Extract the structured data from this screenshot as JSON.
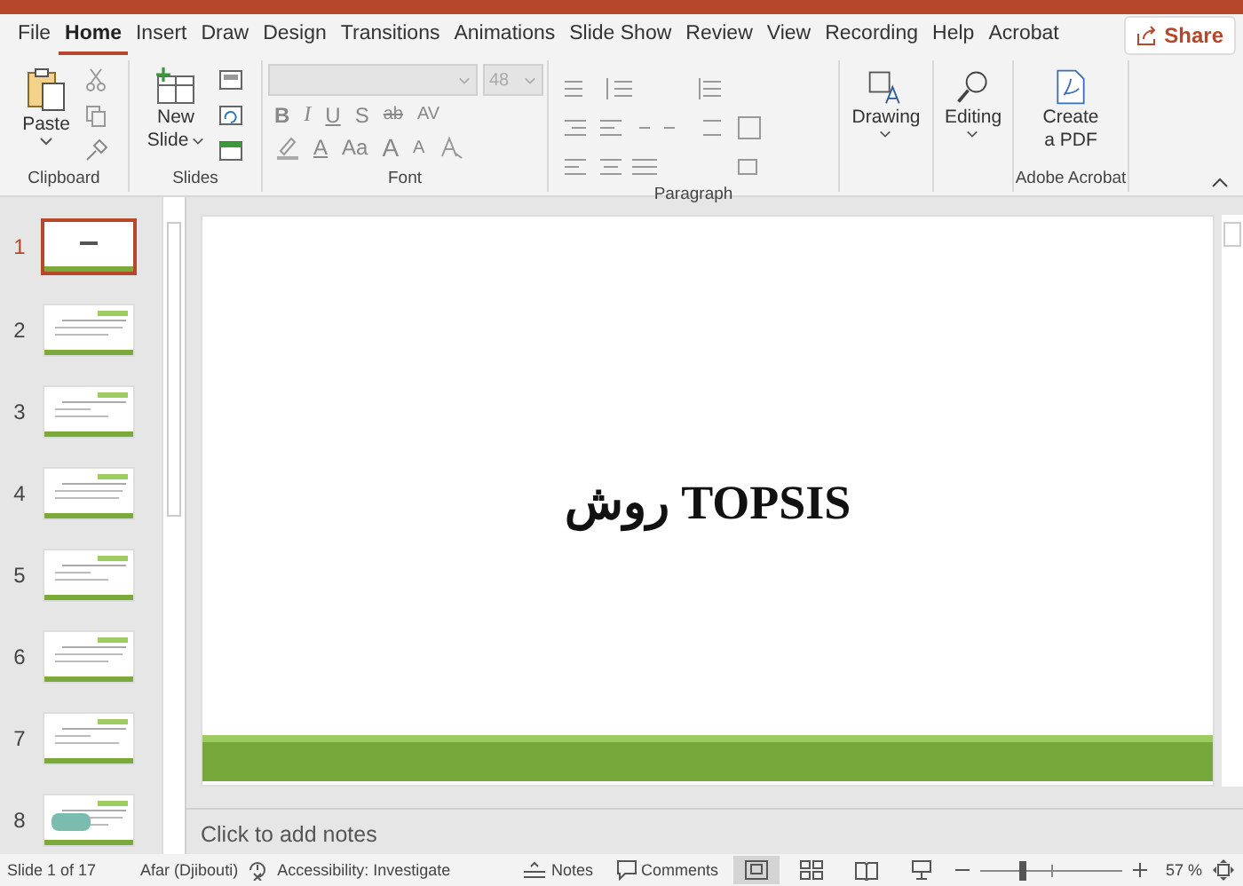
{
  "tabs": [
    {
      "label": "File",
      "selected": false
    },
    {
      "label": "Home",
      "selected": true
    },
    {
      "label": "Insert",
      "selected": false
    },
    {
      "label": "Draw",
      "selected": false
    },
    {
      "label": "Design",
      "selected": false
    },
    {
      "label": "Transitions",
      "selected": false
    },
    {
      "label": "Animations",
      "selected": false
    },
    {
      "label": "Slide Show",
      "selected": false
    },
    {
      "label": "Review",
      "selected": false
    },
    {
      "label": "View",
      "selected": false
    },
    {
      "label": "Recording",
      "selected": false
    },
    {
      "label": "Help",
      "selected": false
    },
    {
      "label": "Acrobat",
      "selected": false
    }
  ],
  "share": {
    "label": "Share"
  },
  "ribbon": {
    "clipboard": {
      "label": "Clipboard",
      "paste": "Paste"
    },
    "slides": {
      "label": "Slides",
      "new_slide": [
        "New",
        "Slide"
      ]
    },
    "font": {
      "label": "Font",
      "size": "48",
      "format_buttons": [
        "B",
        "I",
        "U",
        "S",
        "ab",
        "AV"
      ],
      "font_color": "A",
      "case": "Aa",
      "grow": "A",
      "shrink": "A"
    },
    "paragraph": {
      "label": "Paragraph"
    },
    "drawing": {
      "label": "Drawing"
    },
    "editing": {
      "label": "Editing"
    },
    "acrobat": {
      "label": "Adobe Acrobat",
      "create_pdf": [
        "Create",
        "a PDF"
      ]
    }
  },
  "slides": [
    {
      "number": "1",
      "selected": true
    },
    {
      "number": "2",
      "selected": false
    },
    {
      "number": "3",
      "selected": false
    },
    {
      "number": "4",
      "selected": false
    },
    {
      "number": "5",
      "selected": false
    },
    {
      "number": "6",
      "selected": false
    },
    {
      "number": "7",
      "selected": false
    },
    {
      "number": "8",
      "selected": false
    }
  ],
  "slide": {
    "title": "روش TOPSIS"
  },
  "notes": {
    "placeholder": "Click to add notes"
  },
  "status_bar": {
    "slide_count": "Slide 1 of 17",
    "language": "Afar (Djibouti)",
    "accessibility": "Accessibility: Investigate",
    "notes": "Notes",
    "comments": "Comments",
    "views": [
      {
        "kind": "normal",
        "selected": true
      },
      {
        "kind": "sorter",
        "selected": false
      },
      {
        "kind": "reading",
        "selected": false
      },
      {
        "kind": "slideshow",
        "selected": false
      }
    ],
    "zoom": {
      "level": 0.3,
      "reading": "57 %"
    }
  }
}
